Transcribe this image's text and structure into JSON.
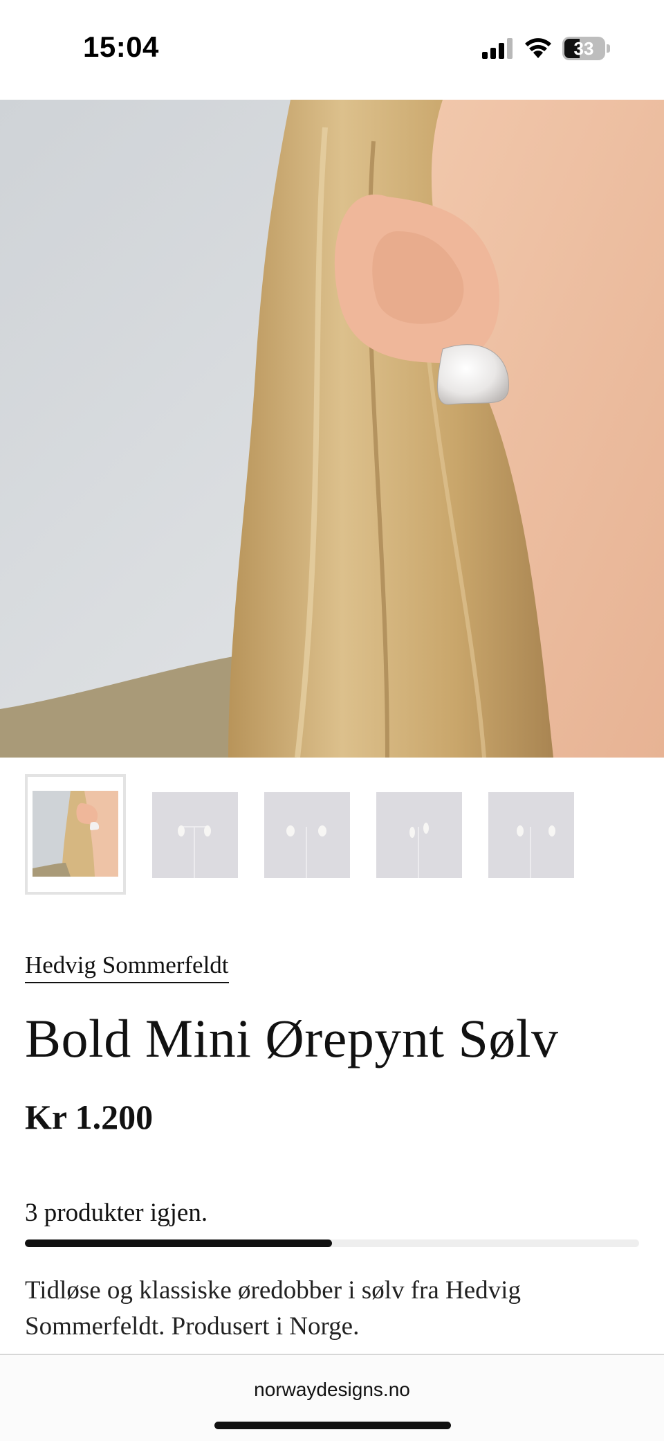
{
  "status_bar": {
    "time": "15:04",
    "battery_level": "33",
    "icons": [
      "signal-icon",
      "wifi-icon",
      "battery-icon"
    ]
  },
  "gallery": {
    "main_image": "woman-ear-silver-earring-photo",
    "thumbnails": [
      {
        "name": "thumbnail-model",
        "active": true
      },
      {
        "name": "thumbnail-earring-stand-1",
        "active": false
      },
      {
        "name": "thumbnail-earring-stand-2",
        "active": false
      },
      {
        "name": "thumbnail-earring-stand-3",
        "active": false
      },
      {
        "name": "thumbnail-earring-stand-4",
        "active": false
      }
    ]
  },
  "product": {
    "brand": "Hedvig Sommerfeldt",
    "title": "Bold Mini Ørepynt Sølv",
    "price": "Kr 1.200",
    "stock_text": "3 produkter igjen.",
    "stock_fraction": 0.5,
    "description": "Tidløse og klassiske øredobber i sølv fra Hedvig Sommerfeldt. Produsert i Norge."
  },
  "browser": {
    "url": "norwaydesigns.no"
  },
  "colors": {
    "text": "#111111",
    "background": "#ffffff",
    "stock_bar_track": "#eeeeee",
    "stock_bar_fill": "#111111"
  }
}
